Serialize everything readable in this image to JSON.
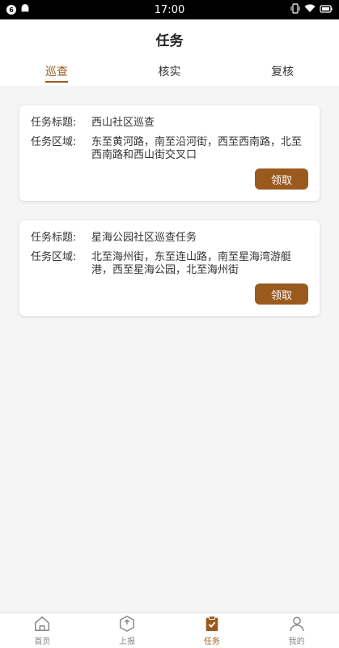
{
  "statusbar": {
    "time": "17:00",
    "badge": "6"
  },
  "header": {
    "title": "任务"
  },
  "tabs": [
    {
      "label": "巡查",
      "active": true
    },
    {
      "label": "核实",
      "active": false
    },
    {
      "label": "复核",
      "active": false
    }
  ],
  "tasks": [
    {
      "title_label": "任务标题:",
      "title": "西山社区巡查",
      "area_label": "任务区域:",
      "area": "东至黄河路，南至沿河街，西至西南路，北至西南路和西山街交叉口",
      "button": "领取"
    },
    {
      "title_label": "任务标题:",
      "title": "星海公园社区巡查任务",
      "area_label": "任务区域:",
      "area": "北至海州街，东至连山路，南至星海湾游艇港，西至星海公园，北至海州街",
      "button": "领取"
    }
  ],
  "tabbar": [
    {
      "label": "首页",
      "icon": "home-icon",
      "active": false
    },
    {
      "label": "上报",
      "icon": "upload-box-icon",
      "active": false
    },
    {
      "label": "任务",
      "icon": "clipboard-check-icon",
      "active": true
    },
    {
      "label": "我的",
      "icon": "user-icon",
      "active": false
    }
  ],
  "colors": {
    "accent": "#9a5a1e",
    "inactive": "#888888"
  }
}
